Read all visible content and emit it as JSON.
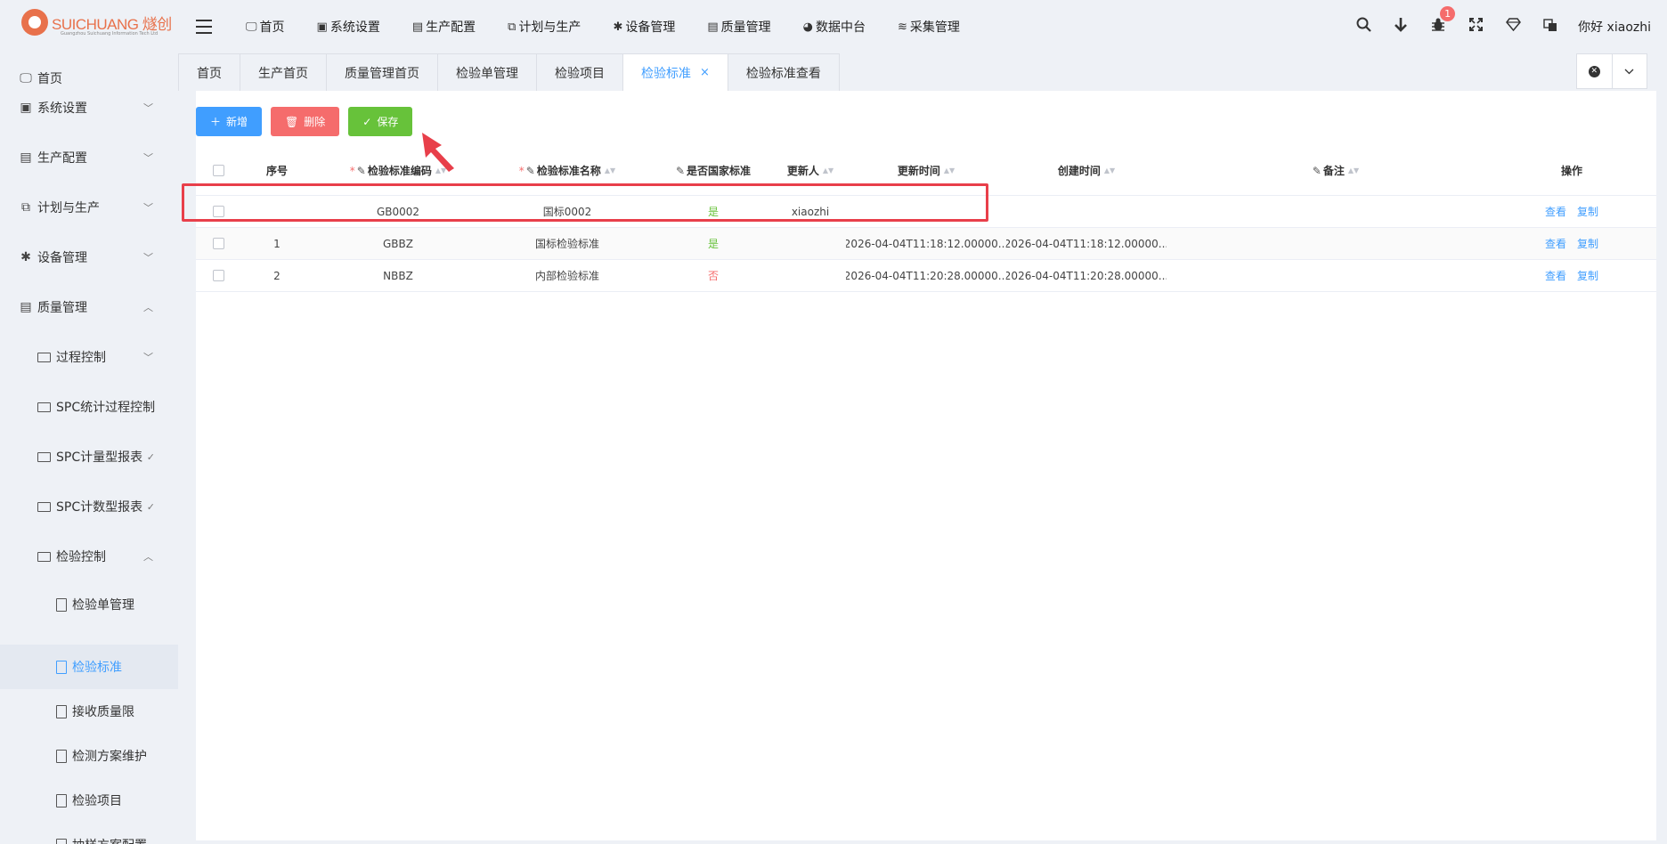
{
  "header": {
    "logo_text": "SUICHUANG 燧创",
    "logo_sub": "Guangzhou Suichuang Information Tech Ltd",
    "nav": [
      {
        "icon": "monitor-icon",
        "glyph": "🖵",
        "label": "首页"
      },
      {
        "icon": "user-badge-icon",
        "glyph": "▣",
        "label": "系统设置"
      },
      {
        "icon": "briefcase-icon",
        "glyph": "▤",
        "label": "生产配置"
      },
      {
        "icon": "clone-icon",
        "glyph": "⧉",
        "label": "计划与生产"
      },
      {
        "icon": "asterisk-icon",
        "glyph": "✱",
        "label": "设备管理"
      },
      {
        "icon": "briefcase-icon",
        "glyph": "▤",
        "label": "质量管理"
      },
      {
        "icon": "pie-chart-icon",
        "glyph": "◕",
        "label": "数据中台"
      },
      {
        "icon": "database-icon",
        "glyph": "≋",
        "label": "采集管理"
      }
    ],
    "badge_count": "1",
    "greeting": "你好 xiaozhi"
  },
  "sidebar": {
    "items": [
      {
        "label": "首页",
        "icon": "monitor-icon",
        "glyph": "🖵",
        "chevron": ""
      },
      {
        "label": "系统设置",
        "icon": "user-badge-icon",
        "glyph": "▣",
        "chevron": "﹀"
      },
      {
        "label": "生产配置",
        "icon": "briefcase-icon",
        "glyph": "▤",
        "chevron": "﹀"
      },
      {
        "label": "计划与生产",
        "icon": "clone-icon",
        "glyph": "⧉",
        "chevron": "﹀"
      },
      {
        "label": "设备管理",
        "icon": "asterisk-icon",
        "glyph": "✱",
        "chevron": "﹀"
      },
      {
        "label": "质量管理",
        "icon": "briefcase-icon",
        "glyph": "▤",
        "chevron": "︿"
      },
      {
        "label": "过程控制",
        "icon": "folder-icon",
        "chevron": "﹀"
      },
      {
        "label": "SPC统计过程控制",
        "icon": "folder-icon",
        "chevron": ""
      },
      {
        "label": "SPC计量型报表",
        "icon": "folder-icon",
        "chevron": "✓"
      },
      {
        "label": "SPC计数型报表",
        "icon": "folder-icon",
        "chevron": "✓"
      },
      {
        "label": "检验控制",
        "icon": "folder-icon",
        "chevron": "︿"
      },
      {
        "label": "检验单管理",
        "icon": "file-icon",
        "chevron": ""
      },
      {
        "label": "检验标准",
        "icon": "file-icon",
        "chevron": ""
      },
      {
        "label": "接收质量限",
        "icon": "file-icon",
        "chevron": ""
      },
      {
        "label": "检测方案维护",
        "icon": "file-icon",
        "chevron": ""
      },
      {
        "label": "检验项目",
        "icon": "file-icon",
        "chevron": ""
      },
      {
        "label": "抽样方案配置",
        "icon": "file-icon",
        "chevron": ""
      }
    ]
  },
  "tabs": [
    {
      "label": "首页"
    },
    {
      "label": "生产首页"
    },
    {
      "label": "质量管理首页"
    },
    {
      "label": "检验单管理"
    },
    {
      "label": "检验项目"
    },
    {
      "label": "检验标准",
      "close": "×"
    },
    {
      "label": "检验标准查看"
    }
  ],
  "toolbar": {
    "add_label": "新增",
    "delete_label": "删除",
    "save_label": "保存"
  },
  "table": {
    "headers": {
      "index": "序号",
      "code": "检验标准编码",
      "name": "检验标准名称",
      "national": "是否国家标准",
      "updater": "更新人",
      "update_time": "更新时间",
      "create_time": "创建时间",
      "remark": "备注",
      "actions": "操作"
    },
    "rows": [
      {
        "index": "",
        "code": "GB0002",
        "name": "国标0002",
        "national": "是",
        "updater": "xiaozhi",
        "update_time": "",
        "create_time": "",
        "remark": "",
        "view": "查看",
        "copy": "复制"
      },
      {
        "index": "1",
        "code": "GBBZ",
        "name": "国标检验标准",
        "national": "是",
        "updater": "",
        "update_time": "2026-04-04T11:18:12.00000...",
        "create_time": "2026-04-04T11:18:12.00000...",
        "remark": "",
        "view": "查看",
        "copy": "复制"
      },
      {
        "index": "2",
        "code": "NBBZ",
        "name": "内部检验标准",
        "national": "否",
        "updater": "",
        "update_time": "2026-04-04T11:20:28.00000...",
        "create_time": "2026-04-04T11:20:28.00000...",
        "remark": "",
        "view": "查看",
        "copy": "复制"
      }
    ]
  },
  "colors": {
    "primary": "#409eff",
    "danger": "#f56c6c",
    "success": "#67c23a",
    "annotation": "#e83f4a"
  }
}
